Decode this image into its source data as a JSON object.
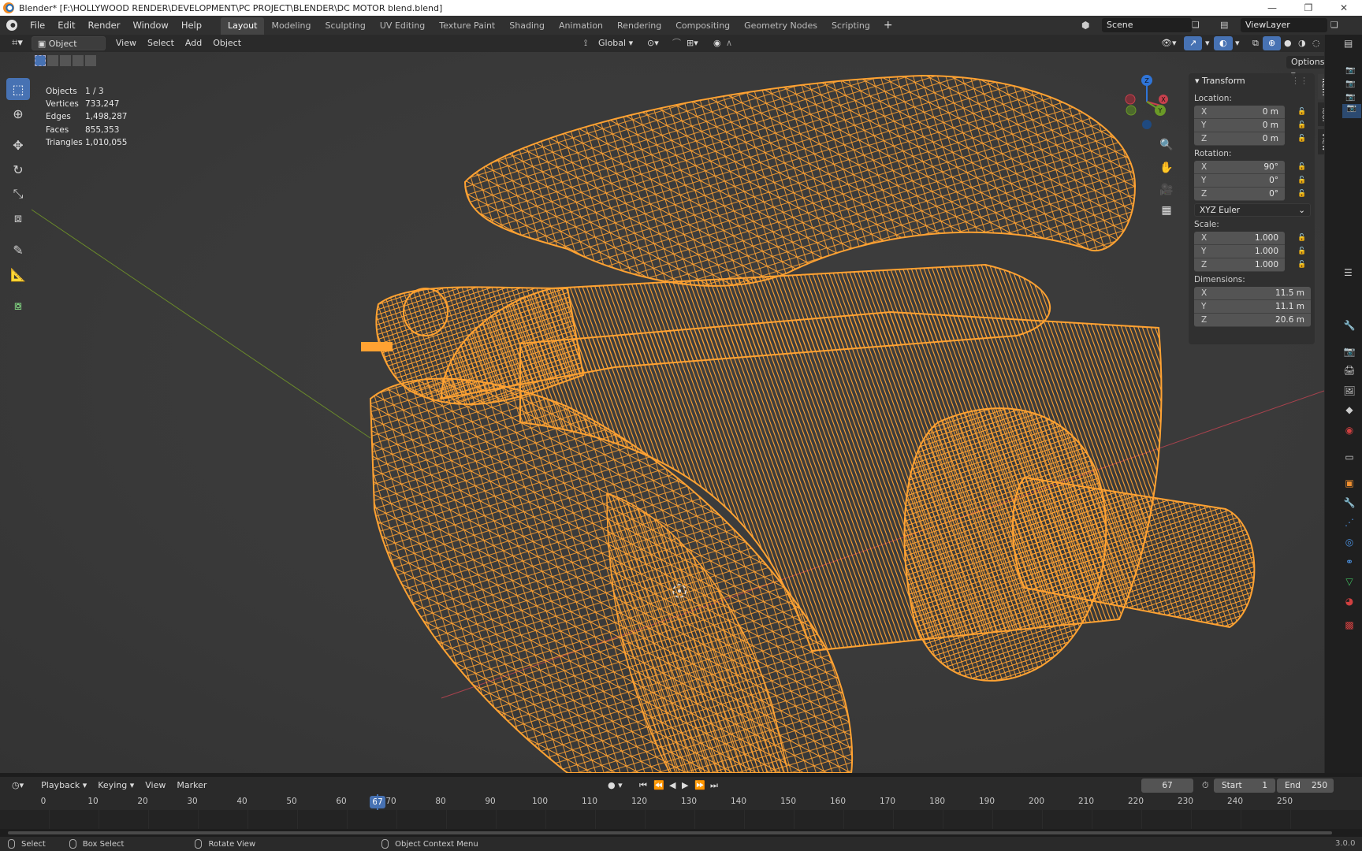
{
  "window": {
    "title": "Blender* [F:\\HOLLYWOOD RENDER\\DEVELOPMENT\\PC PROJECT\\BLENDER\\DC MOTOR blend.blend]"
  },
  "menu": [
    "File",
    "Edit",
    "Render",
    "Window",
    "Help"
  ],
  "workspaces": [
    "Layout",
    "Modeling",
    "Sculpting",
    "UV Editing",
    "Texture Paint",
    "Shading",
    "Animation",
    "Rendering",
    "Compositing",
    "Geometry Nodes",
    "Scripting"
  ],
  "active_workspace": "Layout",
  "scene": {
    "name": "Scene",
    "view_layer": "ViewLayer"
  },
  "viewport_header": {
    "mode": "Object Mode",
    "menus": [
      "View",
      "Select",
      "Add",
      "Object"
    ],
    "orientation": "Global",
    "options_label": "Options"
  },
  "stats": [
    {
      "label": "Objects",
      "value": "1 / 3"
    },
    {
      "label": "Vertices",
      "value": "733,247"
    },
    {
      "label": "Edges",
      "value": "1,498,287"
    },
    {
      "label": "Faces",
      "value": "855,353"
    },
    {
      "label": "Triangles",
      "value": "1,010,055"
    }
  ],
  "transform": {
    "title": "Transform",
    "location_label": "Location:",
    "rotation_label": "Rotation:",
    "scale_label": "Scale:",
    "dimensions_label": "Dimensions:",
    "location": {
      "x": "0 m",
      "y": "0 m",
      "z": "0 m"
    },
    "rotation": {
      "x": "90°",
      "y": "0°",
      "z": "0°"
    },
    "rotation_mode": "XYZ Euler",
    "scale": {
      "x": "1.000",
      "y": "1.000",
      "z": "1.000"
    },
    "dimensions": {
      "x": "11.5 m",
      "y": "11.1 m",
      "z": "20.6 m"
    },
    "axis_labels": {
      "x": "X",
      "y": "Y",
      "z": "Z"
    }
  },
  "side_tabs": [
    "Item",
    "Tool",
    "View"
  ],
  "gizmo": {
    "x": "X",
    "y": "Y",
    "z": "Z"
  },
  "timeline": {
    "menus": [
      "Playback",
      "Keying",
      "View",
      "Marker"
    ],
    "current_frame": "67",
    "start_label": "Start",
    "start": "1",
    "end_label": "End",
    "end": "250",
    "ticks": [
      "0",
      "10",
      "20",
      "30",
      "40",
      "50",
      "60",
      "70",
      "80",
      "90",
      "100",
      "110",
      "120",
      "130",
      "140",
      "150",
      "160",
      "170",
      "180",
      "190",
      "200",
      "210",
      "220",
      "230",
      "240",
      "250"
    ]
  },
  "status": {
    "select": "Select",
    "box_select": "Box Select",
    "rotate_view": "Rotate View",
    "context_menu": "Object Context Menu",
    "version": "3.0.0"
  },
  "colors": {
    "wire": "#ffa232",
    "active_blue": "#4772b3",
    "viewport_bg": "#393939",
    "axis_x": "#c8404d",
    "axis_y": "#6a9a27",
    "axis_z": "#2f75d9"
  }
}
